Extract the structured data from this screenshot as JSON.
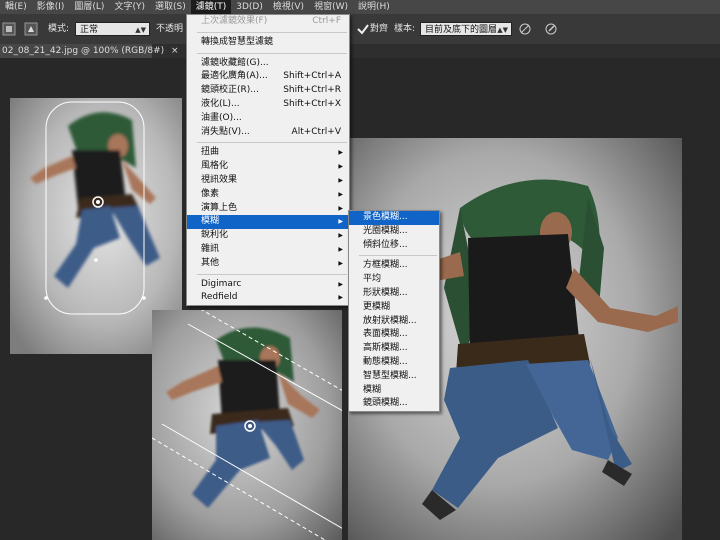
{
  "menubar": {
    "items": [
      "輯(E)",
      "影像(I)",
      "圖層(L)",
      "文字(Y)",
      "選取(S)",
      "濾鏡(T)",
      "3D(D)",
      "檢視(V)",
      "視窗(W)",
      "說明(H)"
    ],
    "active_index": 5
  },
  "options": {
    "mode_label": "模式:",
    "mode_value": "正常",
    "opacity_label": "不透明",
    "align_label": "對齊",
    "sample_label": "樣本:",
    "sample_value": "目前及底下的圖層"
  },
  "document": {
    "tab_title": "02_08_21_42.jpg @ 100% (RGB/8#)",
    "close_glyph": "×"
  },
  "filter_menu": {
    "items": [
      {
        "label": "上次濾鏡效果(F)",
        "shortcut": "Ctrl+F",
        "disabled": true
      },
      {
        "sep": true
      },
      {
        "label": "轉換成智慧型濾鏡"
      },
      {
        "sep": true
      },
      {
        "label": "濾鏡收藏館(G)..."
      },
      {
        "label": "最適化廣角(A)...",
        "shortcut": "Shift+Ctrl+A"
      },
      {
        "label": "鏡頭校正(R)...",
        "shortcut": "Shift+Ctrl+R"
      },
      {
        "label": "液化(L)...",
        "shortcut": "Shift+Ctrl+X"
      },
      {
        "label": "油畫(O)..."
      },
      {
        "label": "消失點(V)...",
        "shortcut": "Alt+Ctrl+V"
      },
      {
        "sep": true
      },
      {
        "label": "扭曲",
        "submenu": true
      },
      {
        "label": "風格化",
        "submenu": true
      },
      {
        "label": "視訊效果",
        "submenu": true
      },
      {
        "label": "像素",
        "submenu": true
      },
      {
        "label": "演算上色",
        "submenu": true
      },
      {
        "label": "模糊",
        "submenu": true,
        "highlighted": true
      },
      {
        "label": "銳利化",
        "submenu": true
      },
      {
        "label": "雜訊",
        "submenu": true
      },
      {
        "label": "其他",
        "submenu": true
      },
      {
        "sep": true
      },
      {
        "label": "Digimarc",
        "submenu": true
      },
      {
        "label": "Redfield",
        "submenu": true
      }
    ]
  },
  "blur_submenu": {
    "items": [
      {
        "label": "景色模糊...",
        "highlighted": true
      },
      {
        "label": "光圈模糊..."
      },
      {
        "label": "傾斜位移..."
      },
      {
        "sep": true
      },
      {
        "label": "方框模糊..."
      },
      {
        "label": "平均"
      },
      {
        "label": "形狀模糊..."
      },
      {
        "label": "更模糊"
      },
      {
        "label": "放射狀模糊..."
      },
      {
        "label": "表面模糊..."
      },
      {
        "label": "高斯模糊..."
      },
      {
        "label": "動態模糊..."
      },
      {
        "label": "智慧型模糊..."
      },
      {
        "label": "模糊"
      },
      {
        "label": "鏡頭模糊..."
      }
    ]
  },
  "colors": {
    "menu_highlight": "#1064c8",
    "app_bg": "#282828",
    "jacket": "#2f5a37",
    "jeans": "#3c5c88"
  }
}
